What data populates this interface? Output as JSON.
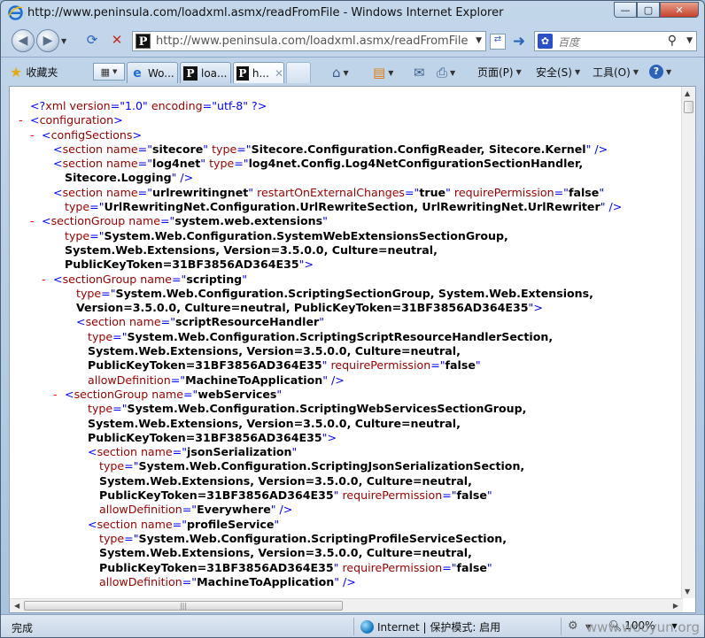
{
  "window": {
    "title": "http://www.peninsula.com/loadxml.asmx/readFromFile - Windows Internet Explorer",
    "minimize": "—",
    "maximize": "▢",
    "close": "✕"
  },
  "nav": {
    "address": "http://www.peninsula.com/loadxml.asmx/readFromFile",
    "search_placeholder": "百度"
  },
  "toolbar": {
    "favorites": "收藏夹",
    "tabs": [
      {
        "label": "Wo...",
        "icon": "ie-icon"
      },
      {
        "label": "loa...",
        "icon": "p-favicon"
      },
      {
        "label": "h...",
        "icon": "p-favicon",
        "active": true
      }
    ],
    "page_menu": "页面(P)",
    "safety_menu": "安全(S)",
    "tools_menu": "工具(O)"
  },
  "xml": {
    "lines": [
      {
        "indent": 0,
        "marker": "",
        "html": "<span class=\"b\">&lt;?</span><span class=\"t\">xml</span> <span class=\"a\">version</span><span class=\"b\">=\"1.0\"</span> <span class=\"a\">encoding</span><span class=\"b\">=\"utf-8\"</span> <span class=\"b\">?&gt;</span>"
      },
      {
        "indent": 0,
        "marker": "-",
        "html": "<span class=\"b\">&lt;</span><span class=\"t\">configuration</span><span class=\"b\">&gt;</span>"
      },
      {
        "indent": 1,
        "marker": "-",
        "html": "<span class=\"b\">&lt;</span><span class=\"t\">configSections</span><span class=\"b\">&gt;</span>"
      },
      {
        "indent": 2,
        "marker": "",
        "html": "<span class=\"b\">&lt;</span><span class=\"t\">section</span> <span class=\"a\">name</span><span class=\"b\">=\"</span><span class=\"v\">sitecore</span><span class=\"b\">\"</span> <span class=\"a\">type</span><span class=\"b\">=\"</span><span class=\"v\">Sitecore.Configuration.ConfigReader, Sitecore.Kernel</span><span class=\"b\">\" /&gt;</span>"
      },
      {
        "indent": 2,
        "marker": "",
        "html": "<span class=\"b\">&lt;</span><span class=\"t\">section</span> <span class=\"a\">name</span><span class=\"b\">=\"</span><span class=\"v\">log4net</span><span class=\"b\">\"</span> <span class=\"a\">type</span><span class=\"b\">=\"</span><span class=\"v\">log4net.Config.Log4NetConfigurationSectionHandler,</span>"
      },
      {
        "indent": 3,
        "marker": "",
        "html": "<span class=\"v\">Sitecore.Logging</span><span class=\"b\">\" /&gt;</span>"
      },
      {
        "indent": 2,
        "marker": "",
        "html": "<span class=\"b\">&lt;</span><span class=\"t\">section</span> <span class=\"a\">name</span><span class=\"b\">=\"</span><span class=\"v\">urlrewritingnet</span><span class=\"b\">\"</span> <span class=\"a\">restartOnExternalChanges</span><span class=\"b\">=\"</span><span class=\"v\">true</span><span class=\"b\">\"</span> <span class=\"a\">requirePermission</span><span class=\"b\">=\"</span><span class=\"v\">false</span><span class=\"b\">\"</span>"
      },
      {
        "indent": 3,
        "marker": "",
        "html": "<span class=\"a\">type</span><span class=\"b\">=\"</span><span class=\"v\">UrlRewritingNet.Configuration.UrlRewriteSection, UrlRewritingNet.UrlRewriter</span><span class=\"b\">\" /&gt;</span>"
      },
      {
        "indent": 1,
        "marker": "-",
        "html": "<span class=\"b\">&lt;</span><span class=\"t\">sectionGroup</span> <span class=\"a\">name</span><span class=\"b\">=\"</span><span class=\"v\">system.web.extensions</span><span class=\"b\">\"</span>"
      },
      {
        "indent": 3,
        "marker": "",
        "html": "<span class=\"a\">type</span><span class=\"b\">=\"</span><span class=\"v\">System.Web.Configuration.SystemWebExtensionsSectionGroup,</span>"
      },
      {
        "indent": 3,
        "marker": "",
        "html": "<span class=\"v\">System.Web.Extensions, Version=3.5.0.0, Culture=neutral,</span>"
      },
      {
        "indent": 3,
        "marker": "",
        "html": "<span class=\"v\">PublicKeyToken=31BF3856AD364E35</span><span class=\"b\">\"&gt;</span>"
      },
      {
        "indent": 2,
        "marker": "-",
        "html": "<span class=\"b\">&lt;</span><span class=\"t\">sectionGroup</span> <span class=\"a\">name</span><span class=\"b\">=\"</span><span class=\"v\">scripting</span><span class=\"b\">\"</span>"
      },
      {
        "indent": 4,
        "marker": "",
        "html": "<span class=\"a\">type</span><span class=\"b\">=\"</span><span class=\"v\">System.Web.Configuration.ScriptingSectionGroup, System.Web.Extensions,</span>"
      },
      {
        "indent": 4,
        "marker": "",
        "html": "<span class=\"v\">Version=3.5.0.0, Culture=neutral, PublicKeyToken=31BF3856AD364E35</span><span class=\"b\">\"&gt;</span>"
      },
      {
        "indent": 4,
        "marker": "",
        "html": "<span class=\"b\">&lt;</span><span class=\"t\">section</span> <span class=\"a\">name</span><span class=\"b\">=\"</span><span class=\"v\">scriptResourceHandler</span><span class=\"b\">\"</span>"
      },
      {
        "indent": 5,
        "marker": "",
        "html": "<span class=\"a\">type</span><span class=\"b\">=\"</span><span class=\"v\">System.Web.Configuration.ScriptingScriptResourceHandlerSection,</span>"
      },
      {
        "indent": 5,
        "marker": "",
        "html": "<span class=\"v\">System.Web.Extensions, Version=3.5.0.0, Culture=neutral,</span>"
      },
      {
        "indent": 5,
        "marker": "",
        "html": "<span class=\"v\">PublicKeyToken=31BF3856AD364E35</span><span class=\"b\">\"</span> <span class=\"a\">requirePermission</span><span class=\"b\">=\"</span><span class=\"v\">false</span><span class=\"b\">\"</span>"
      },
      {
        "indent": 5,
        "marker": "",
        "html": "<span class=\"a\">allowDefinition</span><span class=\"b\">=\"</span><span class=\"v\">MachineToApplication</span><span class=\"b\">\" /&gt;</span>"
      },
      {
        "indent": 3,
        "marker": "-",
        "html": "<span class=\"b\">&lt;</span><span class=\"t\">sectionGroup</span> <span class=\"a\">name</span><span class=\"b\">=\"</span><span class=\"v\">webServices</span><span class=\"b\">\"</span>"
      },
      {
        "indent": 5,
        "marker": "",
        "html": "<span class=\"a\">type</span><span class=\"b\">=\"</span><span class=\"v\">System.Web.Configuration.ScriptingWebServicesSectionGroup,</span>"
      },
      {
        "indent": 5,
        "marker": "",
        "html": "<span class=\"v\">System.Web.Extensions, Version=3.5.0.0, Culture=neutral,</span>"
      },
      {
        "indent": 5,
        "marker": "",
        "html": "<span class=\"v\">PublicKeyToken=31BF3856AD364E35</span><span class=\"b\">\"&gt;</span>"
      },
      {
        "indent": 5,
        "marker": "",
        "html": "<span class=\"b\">&lt;</span><span class=\"t\">section</span> <span class=\"a\">name</span><span class=\"b\">=\"</span><span class=\"v\">jsonSerialization</span><span class=\"b\">\"</span>"
      },
      {
        "indent": 6,
        "marker": "",
        "html": "<span class=\"a\">type</span><span class=\"b\">=\"</span><span class=\"v\">System.Web.Configuration.ScriptingJsonSerializationSection,</span>"
      },
      {
        "indent": 6,
        "marker": "",
        "html": "<span class=\"v\">System.Web.Extensions, Version=3.5.0.0, Culture=neutral,</span>"
      },
      {
        "indent": 6,
        "marker": "",
        "html": "<span class=\"v\">PublicKeyToken=31BF3856AD364E35</span><span class=\"b\">\"</span> <span class=\"a\">requirePermission</span><span class=\"b\">=\"</span><span class=\"v\">false</span><span class=\"b\">\"</span>"
      },
      {
        "indent": 6,
        "marker": "",
        "html": "<span class=\"a\">allowDefinition</span><span class=\"b\">=\"</span><span class=\"v\">Everywhere</span><span class=\"b\">\" /&gt;</span>"
      },
      {
        "indent": 5,
        "marker": "",
        "html": "<span class=\"b\">&lt;</span><span class=\"t\">section</span> <span class=\"a\">name</span><span class=\"b\">=\"</span><span class=\"v\">profileService</span><span class=\"b\">\"</span>"
      },
      {
        "indent": 6,
        "marker": "",
        "html": "<span class=\"a\">type</span><span class=\"b\">=\"</span><span class=\"v\">System.Web.Configuration.ScriptingProfileServiceSection,</span>"
      },
      {
        "indent": 6,
        "marker": "",
        "html": "<span class=\"v\">System.Web.Extensions, Version=3.5.0.0, Culture=neutral,</span>"
      },
      {
        "indent": 6,
        "marker": "",
        "html": "<span class=\"v\">PublicKeyToken=31BF3856AD364E35</span><span class=\"b\">\"</span> <span class=\"a\">requirePermission</span><span class=\"b\">=\"</span><span class=\"v\">false</span><span class=\"b\">\"</span>"
      },
      {
        "indent": 6,
        "marker": "",
        "html": "<span class=\"a\">allowDefinition</span><span class=\"b\">=\"</span><span class=\"v\">MachineToApplication</span><span class=\"b\">\" /&gt;</span>"
      }
    ]
  },
  "status": {
    "text": "完成",
    "zone": "Internet | 保护模式: 启用",
    "zoom": "100%"
  },
  "watermark": "www.wooyun.org"
}
